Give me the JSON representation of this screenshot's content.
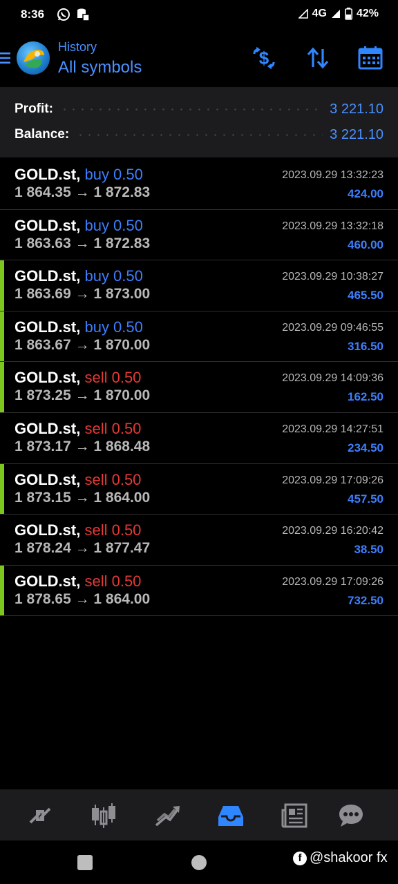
{
  "status_bar": {
    "time": "8:36",
    "network": "4G",
    "battery": "42%",
    "icons": [
      "whatsapp-icon",
      "data-saver-icon",
      "signal-icon",
      "battery-icon"
    ]
  },
  "header": {
    "subtitle": "History",
    "title": "All symbols",
    "actions": [
      "deals-filter-icon",
      "sort-icon",
      "calendar-icon"
    ]
  },
  "summary": {
    "profit_label": "Profit:",
    "profit_value": "3 221.10",
    "balance_label": "Balance:",
    "balance_value": "3 221.10"
  },
  "deals": [
    {
      "symbol": "GOLD.st,",
      "type": "buy 0.50",
      "side": "buy",
      "prices": "1 864.35 → 1 872.83",
      "time": "2023.09.29 13:32:23",
      "profit": "424.00",
      "marked": false
    },
    {
      "symbol": "GOLD.st,",
      "type": "buy 0.50",
      "side": "buy",
      "prices": "1 863.63 → 1 872.83",
      "time": "2023.09.29 13:32:18",
      "profit": "460.00",
      "marked": false
    },
    {
      "symbol": "GOLD.st,",
      "type": "buy 0.50",
      "side": "buy",
      "prices": "1 863.69 → 1 873.00",
      "time": "2023.09.29 10:38:27",
      "profit": "465.50",
      "marked": true
    },
    {
      "symbol": "GOLD.st,",
      "type": "buy 0.50",
      "side": "buy",
      "prices": "1 863.67 → 1 870.00",
      "time": "2023.09.29 09:46:55",
      "profit": "316.50",
      "marked": true
    },
    {
      "symbol": "GOLD.st,",
      "type": "sell 0.50",
      "side": "sell",
      "prices": "1 873.25 → 1 870.00",
      "time": "2023.09.29 14:09:36",
      "profit": "162.50",
      "marked": true
    },
    {
      "symbol": "GOLD.st,",
      "type": "sell 0.50",
      "side": "sell",
      "prices": "1 873.17 → 1 868.48",
      "time": "2023.09.29 14:27:51",
      "profit": "234.50",
      "marked": false
    },
    {
      "symbol": "GOLD.st,",
      "type": "sell 0.50",
      "side": "sell",
      "prices": "1 873.15 → 1 864.00",
      "time": "2023.09.29 17:09:26",
      "profit": "457.50",
      "marked": true
    },
    {
      "symbol": "GOLD.st,",
      "type": "sell 0.50",
      "side": "sell",
      "prices": "1 878.24 → 1 877.47",
      "time": "2023.09.29 16:20:42",
      "profit": "38.50",
      "marked": false
    },
    {
      "symbol": "GOLD.st,",
      "type": "sell 0.50",
      "side": "sell",
      "prices": "1 878.65 → 1 864.00",
      "time": "2023.09.29 17:09:26",
      "profit": "732.50",
      "marked": true
    }
  ],
  "bottom_nav": {
    "items": [
      "quotes-icon",
      "chart-icon",
      "trade-icon",
      "history-icon",
      "news-icon",
      "chat-icon"
    ],
    "active": "history-icon",
    "active_color": "#2f86ff",
    "inactive_color": "#8e8e93"
  },
  "colors": {
    "accent": "#4a90ff",
    "buy": "#3d7fff",
    "sell": "#e53935",
    "marker": "#7cc61e"
  },
  "watermark": {
    "text": "@shakoor fx",
    "icon": "f"
  }
}
